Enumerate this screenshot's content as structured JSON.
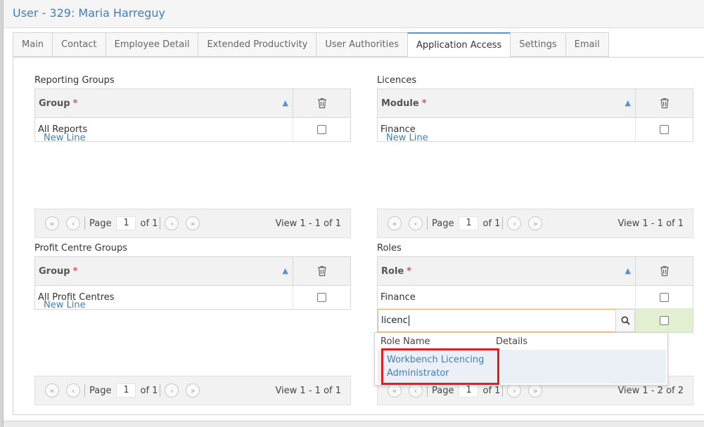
{
  "window": {
    "title": "User - 329: Maria Harreguy"
  },
  "tabs": [
    {
      "label": "Main"
    },
    {
      "label": "Contact"
    },
    {
      "label": "Employee Detail"
    },
    {
      "label": "Extended Productivity"
    },
    {
      "label": "User Authorities"
    },
    {
      "label": "Application Access",
      "active": true
    },
    {
      "label": "Settings"
    },
    {
      "label": "Email"
    }
  ],
  "common": {
    "required_mark": "*",
    "new_line": "New Line",
    "page_label": "Page",
    "page_number": "1",
    "of_label": "of 1"
  },
  "reporting_groups": {
    "title": "Reporting Groups",
    "column": "Group",
    "rows": [
      {
        "value": "All Reports",
        "checked": false
      }
    ],
    "view": "View 1 - 1 of 1"
  },
  "licences": {
    "title": "Licences",
    "column": "Module",
    "rows": [
      {
        "value": "Finance",
        "checked": false
      }
    ],
    "view": "View 1 - 1 of 1"
  },
  "profit_centre_groups": {
    "title": "Profit Centre Groups",
    "column": "Group",
    "rows": [
      {
        "value": "All Profit Centres",
        "checked": false
      }
    ],
    "view": "View 1 - 1 of 1"
  },
  "roles": {
    "title": "Roles",
    "column": "Role",
    "rows": [
      {
        "value": "Finance",
        "checked": false
      }
    ],
    "edit_value": "licenc",
    "view": "View 1 - 2 of 2",
    "lookup": {
      "col_name": "Role Name",
      "col_details": "Details",
      "results": [
        {
          "line1": "Workbench Licencing",
          "line2": "Administrator",
          "details": ""
        }
      ]
    }
  },
  "icons": [
    "trash-icon",
    "sort-icon",
    "first-page-icon",
    "prev-page-icon",
    "next-page-icon",
    "last-page-icon",
    "search-icon"
  ],
  "colors": {
    "accent": "#3f7fb8",
    "required": "#d9534f",
    "highlight": "#e02020",
    "edit_cell": "#e2efd0"
  }
}
